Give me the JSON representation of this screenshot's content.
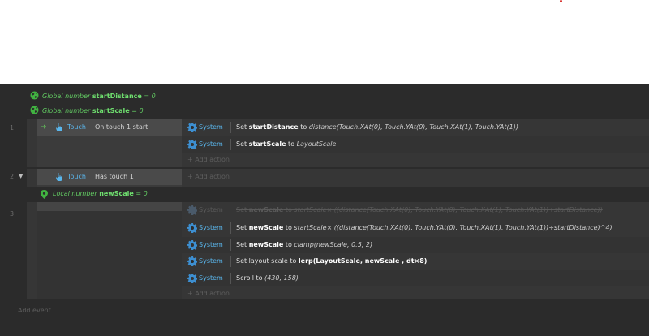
{
  "globals": [
    {
      "prefix": "Global number ",
      "name": "startDistance",
      "suffix": " = 0"
    },
    {
      "prefix": "Global number ",
      "name": "startScale",
      "suffix": " = 0"
    }
  ],
  "events": [
    {
      "number": "1",
      "condition": {
        "object": "Touch",
        "text": "On touch 1 start"
      },
      "actions": [
        {
          "object": "System",
          "pre": "Set ",
          "bold": "startDistance",
          "mid": " to ",
          "italic": "distance(Touch.XAt(0), Touch.YAt(0), Touch.XAt(1), Touch.YAt(1))"
        },
        {
          "object": "System",
          "pre": "Set ",
          "bold": "startScale",
          "mid": " to ",
          "italic": "LayoutScale"
        }
      ],
      "add_action": "+ Add action"
    },
    {
      "number": "2",
      "condition": {
        "object": "Touch",
        "text": "Has touch 1"
      },
      "add_action": "+ Add action",
      "local": {
        "prefix": "Local number ",
        "name": "newScale",
        "suffix": " = 0"
      }
    },
    {
      "number": "3",
      "actions": [
        {
          "object": "System",
          "pre": "Set ",
          "bold": "newScale",
          "mid": " to ",
          "italic": "startScale× ((distance(Touch.XAt(0), Touch.YAt(0), Touch.XAt(1), Touch.YAt(1))÷startDistance))"
        },
        {
          "object": "System",
          "pre": "Set ",
          "bold": "newScale",
          "mid": " to ",
          "italic": "startScale× ((distance(Touch.XAt(0), Touch.YAt(0), Touch.XAt(1), Touch.YAt(1))÷startDistance)^4)"
        },
        {
          "object": "System",
          "pre": "Set ",
          "bold": "newScale",
          "mid": " to ",
          "italic": "clamp(newScale, 0.5, 2)"
        },
        {
          "object": "System",
          "pre": "Set layout scale to ",
          "bold": "lerp(LayoutScale, newScale , dt×8)",
          "mid": "",
          "italic": ""
        },
        {
          "object": "System",
          "pre": "Scroll to ",
          "bold": "",
          "mid": "",
          "italic": "(430, 158)"
        }
      ],
      "add_action": "+ Add action"
    }
  ],
  "add_event": "Add event",
  "colors": {
    "background": "#2b2b2b",
    "variable": "#62c962",
    "object": "#5ab6ec",
    "disabled": "#5a5a5a"
  },
  "icons": {
    "global": "globe-icon",
    "local": "pin-icon",
    "system": "gear-icon",
    "touch": "touch-hand-icon",
    "trigger": "trigger-arrow-icon"
  }
}
